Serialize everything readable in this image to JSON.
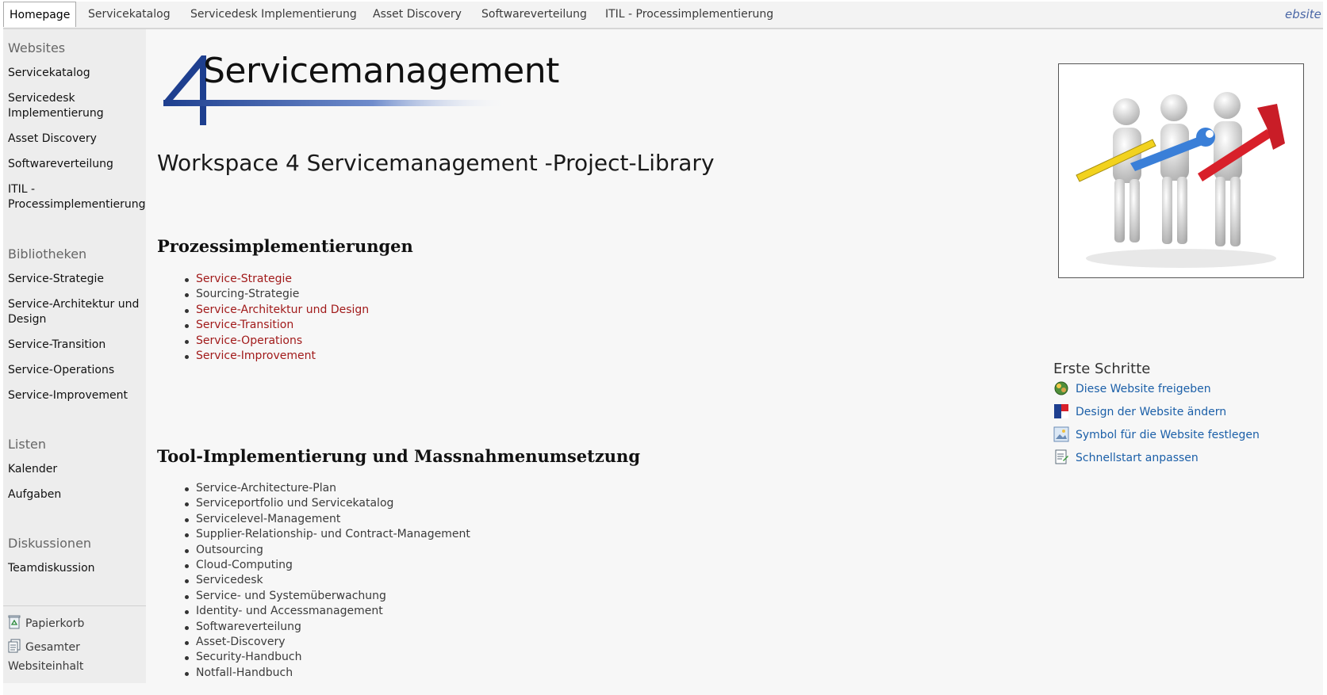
{
  "topnav": {
    "tabs": [
      {
        "label": "Homepage",
        "active": true
      },
      {
        "label": "Servicekatalog"
      },
      {
        "label": "Servicedesk Implementierung"
      },
      {
        "label": "Asset Discovery"
      },
      {
        "label": "Softwareverteilung"
      },
      {
        "label": "ITIL - Processimplementierung"
      }
    ],
    "cutoff_text": "ebsite d"
  },
  "quicklaunch": {
    "websites_heading": "Websites",
    "websites": [
      "Servicekatalog",
      "Servicedesk Implementierung",
      "Asset Discovery",
      "Softwareverteilung",
      "ITIL - Processimplementierung"
    ],
    "libraries_heading": "Bibliotheken",
    "libraries": [
      "Service-Strategie",
      "Service-Architektur und Design",
      "Service-Transition",
      "Service-Operations",
      "Service-Improvement"
    ],
    "lists_heading": "Listen",
    "lists": [
      "Kalender",
      "Aufgaben"
    ],
    "discussions_heading": "Diskussionen",
    "discussions": [
      "Teamdiskussion"
    ],
    "recycle_bin": "Papierkorb",
    "all_content": "Gesamter Websiteinhalt"
  },
  "logo": {
    "digit": "4",
    "text": "Servicemanagement"
  },
  "workspace_title": "Workspace 4 Servicemanagement -Project-Library",
  "section1": {
    "title": "Prozessimplementierungen",
    "items": [
      {
        "label": "Service-Strategie",
        "link": true
      },
      {
        "label": "Sourcing-Strategie",
        "link": false
      },
      {
        "label": "Service-Architektur und Design",
        "link": true
      },
      {
        "label": "Service-Transition",
        "link": true
      },
      {
        "label": "Service-Operations",
        "link": true
      },
      {
        "label": "Service-Improvement",
        "link": true
      }
    ]
  },
  "section2": {
    "title": "Tool-Implementierung und Massnahmenumsetzung",
    "items": [
      "Service-Architecture-Plan",
      "Serviceportfolio und Servicekatalog",
      "Servicelevel-Management",
      "Supplier-Relationship- und Contract-Management",
      "Outsourcing",
      "Cloud-Computing",
      "Servicedesk",
      "Service- und Systemüberwachung",
      "Identity- und Accessmanagement",
      "Softwareverteilung",
      "Asset-Discovery",
      "Security-Handbuch",
      "Notfall-Handbuch"
    ]
  },
  "erste_schritte": {
    "heading": "Erste Schritte",
    "links": [
      {
        "label": "Diese Website freigeben",
        "icon": "share-icon"
      },
      {
        "label": "Design der Website ändern",
        "icon": "theme-icon"
      },
      {
        "label": "Symbol für die Website festlegen",
        "icon": "image-icon"
      },
      {
        "label": "Schnellstart anpassen",
        "icon": "navigation-edit-icon"
      }
    ]
  },
  "colors": {
    "link_red": "#a11a1a",
    "link_blue": "#1b5fa8",
    "logo_blue": "#1e3f8f"
  }
}
